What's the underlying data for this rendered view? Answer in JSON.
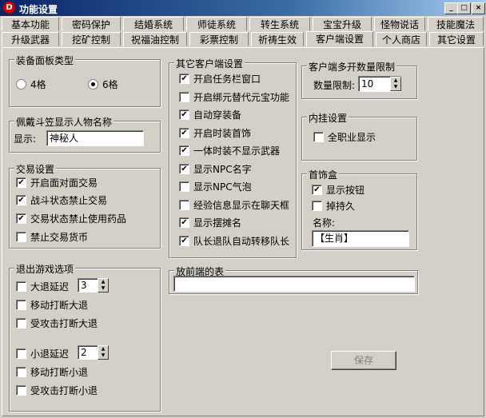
{
  "window": {
    "title": "功能设置",
    "icon_letter": "D"
  },
  "tabs_row1": [
    "基本功能",
    "密码保护",
    "结婚系统",
    "师徒系统",
    "转生系统",
    "宝宝升级",
    "怪物说话",
    "技能魔法"
  ],
  "tabs_row2": [
    "升级武器",
    "挖矿控制",
    "祝福油控制",
    "彩票控制",
    "祈祷生效",
    "客户端设置",
    "个人商店",
    "其它设置"
  ],
  "active_tab": "客户端设置",
  "equip_panel": {
    "legend": "装备面板类型",
    "opt4": "4格",
    "opt6": "6格"
  },
  "hat_name": {
    "legend": "佩戴斗笠显示人物名称",
    "label": "显示:",
    "value": "神秘人"
  },
  "trade": {
    "legend": "交易设置",
    "items": [
      "开启面对面交易",
      "战斗状态禁止交易",
      "交易状态禁止使用药品",
      "禁止交易货币"
    ]
  },
  "exit": {
    "legend": "退出游戏选项",
    "big_delay": "大退延迟",
    "big_value": "3",
    "move_big": "移动打断大退",
    "hit_big": "受攻击打断大退",
    "small_delay": "小退延迟",
    "small_value": "2",
    "move_small": "移动打断小退",
    "hit_small": "受攻击打断小退"
  },
  "other_client": {
    "legend": "其它客户端设置",
    "items": [
      "开启任务栏窗口",
      "开启绑元替代元宝功能",
      "自动穿装备",
      "开启时装首饰",
      "一体时装不显示武器",
      "显示NPC名字",
      "显示NPC气泡",
      "经验信息显示在聊天框",
      "显示摆摊名",
      "队长退队自动转移队长"
    ]
  },
  "multi_client": {
    "legend": "客户端多开数量限制",
    "label": "数量限制:",
    "value": "10"
  },
  "plugin": {
    "legend": "内挂设置",
    "item": "全职业显示"
  },
  "jewelry": {
    "legend": "首饰盒",
    "show_button": "显示按钮",
    "durability": "掉持久",
    "name_label": "名称:",
    "name_value": "【生肖】"
  },
  "front_table": {
    "legend": "放前端的表"
  },
  "save_button": "保存"
}
